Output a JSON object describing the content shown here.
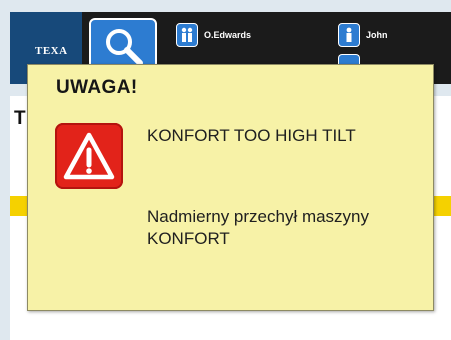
{
  "header": {
    "logo_text": "TEXA",
    "users": [
      {
        "name": "O.Edwards",
        "icon": "user-icon"
      },
      {
        "name": "John",
        "icon": "user-icon"
      }
    ],
    "search_icon": "search-icon"
  },
  "content": {
    "title": "T",
    "accent_color": "#f5d100"
  },
  "dialog": {
    "title": "UWAGA!",
    "icon": "warning-icon",
    "code_text": "KONFORT TOO HIGH TILT",
    "description": "Nadmierny przechył maszyny KONFORT",
    "background_color": "#f7f2a7",
    "icon_color": "#e2231a"
  }
}
